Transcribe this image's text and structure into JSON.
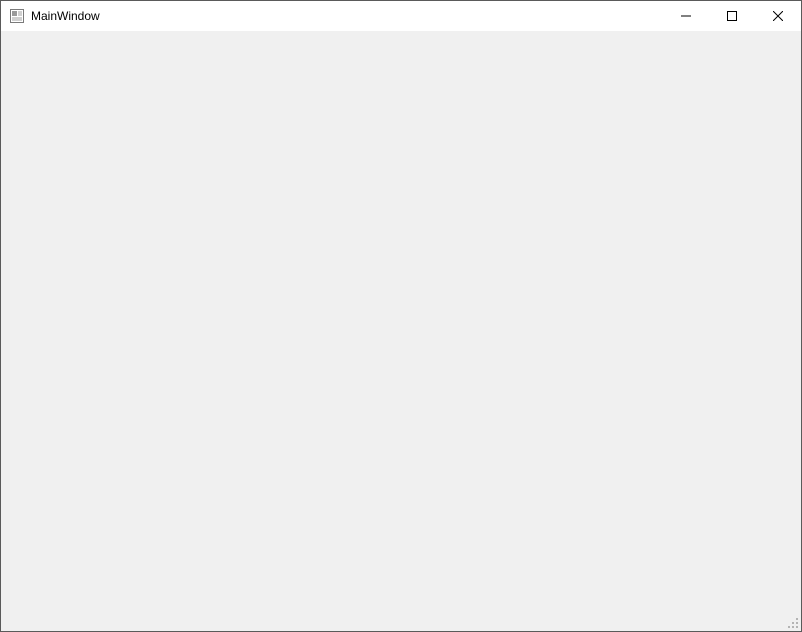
{
  "window": {
    "title": "MainWindow"
  }
}
